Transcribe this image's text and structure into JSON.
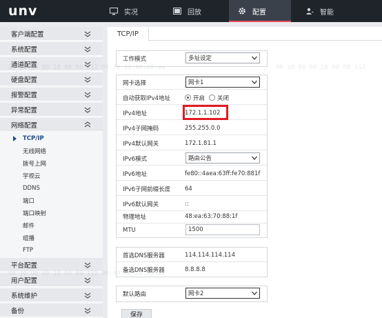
{
  "brand": {
    "logo": "unv"
  },
  "topnav": [
    {
      "label": "实况",
      "icon": "monitor-icon",
      "active": false
    },
    {
      "label": "回放",
      "icon": "film-icon",
      "active": false
    },
    {
      "label": "配置",
      "icon": "gear-icon",
      "active": true
    },
    {
      "label": "智能",
      "icon": "user-scan-icon",
      "active": false
    }
  ],
  "sidebar": {
    "groups_top": [
      "客户端配置",
      "系统配置",
      "通道配置",
      "硬盘配置",
      "报警配置",
      "异常配置",
      "网络配置"
    ],
    "network_sub": [
      "TCP/IP",
      "无线网络",
      "拨号上网",
      "宇视云",
      "DDNS",
      "端口",
      "端口映射",
      "邮件",
      "组播",
      "FTP"
    ],
    "active_sub": "TCP/IP",
    "groups_bottom": [
      "平台配置",
      "用户配置",
      "系统维护",
      "备份"
    ]
  },
  "panel": {
    "tab": "TCP/IP",
    "work_mode": {
      "label": "工作模式",
      "value": "多址设定"
    },
    "nic_select": {
      "label": "网卡选择",
      "value": "网卡1"
    },
    "dhcp": {
      "label": "自动获取IPv4地址",
      "on": "开启",
      "off": "关闭",
      "selected": "on"
    },
    "ipv4_addr": {
      "label": "IPv4地址",
      "value": "172.1.1.102"
    },
    "ipv4_mask": {
      "label": "IPv4子网掩码",
      "value": "255.255.0.0"
    },
    "ipv4_gw": {
      "label": "IPv4默认网关",
      "value": "172.1.81.1"
    },
    "ipv6_mode": {
      "label": "IPv6模式",
      "value": "路由公告"
    },
    "ipv6_addr": {
      "label": "IPv6地址",
      "value": "fe80::4aea:63ff:fe70:881f"
    },
    "ipv6_prefix": {
      "label": "IPv6子网前缀长度",
      "value": "64"
    },
    "ipv6_gw": {
      "label": "IPv6默认网关",
      "value": "::"
    },
    "mac": {
      "label": "物理地址",
      "value": "48:ea:63:70:88:1f"
    },
    "mtu": {
      "label": "MTU",
      "value": "1500"
    },
    "dns1": {
      "label": "首选DNS服务器",
      "value": "114.114.114.114"
    },
    "dns2": {
      "label": "备选DNS服务器",
      "value": "8.8.8.8"
    },
    "default_route": {
      "label": "默认路由",
      "value": "网卡2"
    },
    "save_label": "保存"
  },
  "watermark": [
    "00 10 00 00 10 00 00 112  00:00:00:00:48:ea",
    "00 10 00 00 10 00 00 112",
    "00 10 00 00 10 00 00 112  00:00:00:00:48:ea"
  ],
  "colors": {
    "topbar": "#1f242b",
    "accent": "#e84c5c",
    "highlight": "#e21a22",
    "active_link": "#1c4b8f"
  }
}
